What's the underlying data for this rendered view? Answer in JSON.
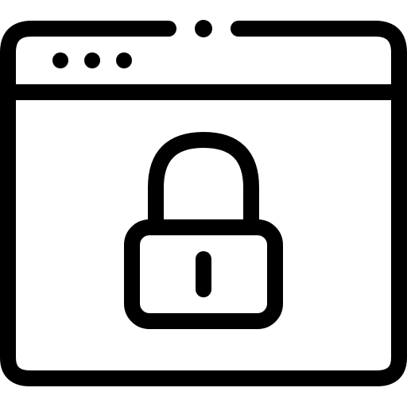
{
  "colors": {
    "stroke": "#000000",
    "background": "#ffffff"
  },
  "icons": {
    "window": "browser-window-icon",
    "lock": "padlock-icon",
    "window_dots": [
      "window-dot-icon",
      "window-dot-icon",
      "window-dot-icon"
    ],
    "top_dot": "top-dot-icon"
  }
}
